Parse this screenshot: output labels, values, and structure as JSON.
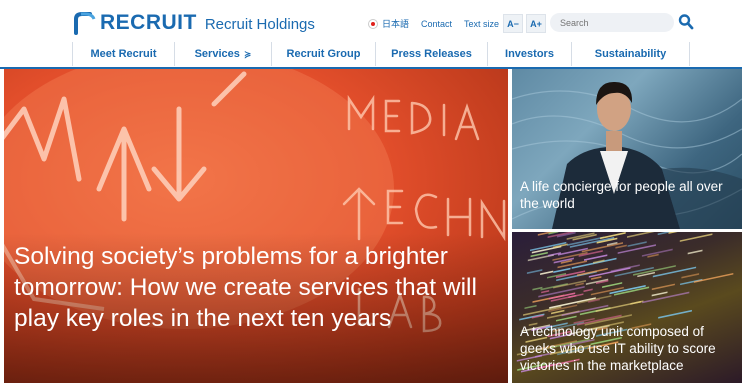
{
  "header": {
    "logo_text": "RECRUIT",
    "logo_sub": "Recruit Holdings",
    "language_label": "日本語",
    "contact_label": "Contact",
    "text_size_label": "Text size",
    "text_size_smaller": "A−",
    "text_size_larger": "A+",
    "search_placeholder": "Search"
  },
  "nav": {
    "items": [
      {
        "label": "Meet Recruit"
      },
      {
        "label": "Services",
        "has_dropdown": true
      },
      {
        "label": "Recruit Group"
      },
      {
        "label": "Press Releases"
      },
      {
        "label": "Investors"
      },
      {
        "label": "Sustainability"
      }
    ],
    "dropdown_glyph": "≽"
  },
  "hero": {
    "title": "Solving society’s problems for a brighter tomorrow: How we create services that will play key roles in the next ten years",
    "image_icon": "media-technology-lab-sign-image"
  },
  "cards": [
    {
      "title": "A life concierge for people all over the world",
      "image_icon": "portrait-photo"
    },
    {
      "title": "A technology unit composed of geeks who use IT ability to score victories in the marketplace",
      "image_icon": "code-screen-photo"
    }
  ],
  "colors": {
    "brand_blue": "#1a6ab0",
    "hero_orange": "#e24e2b"
  }
}
